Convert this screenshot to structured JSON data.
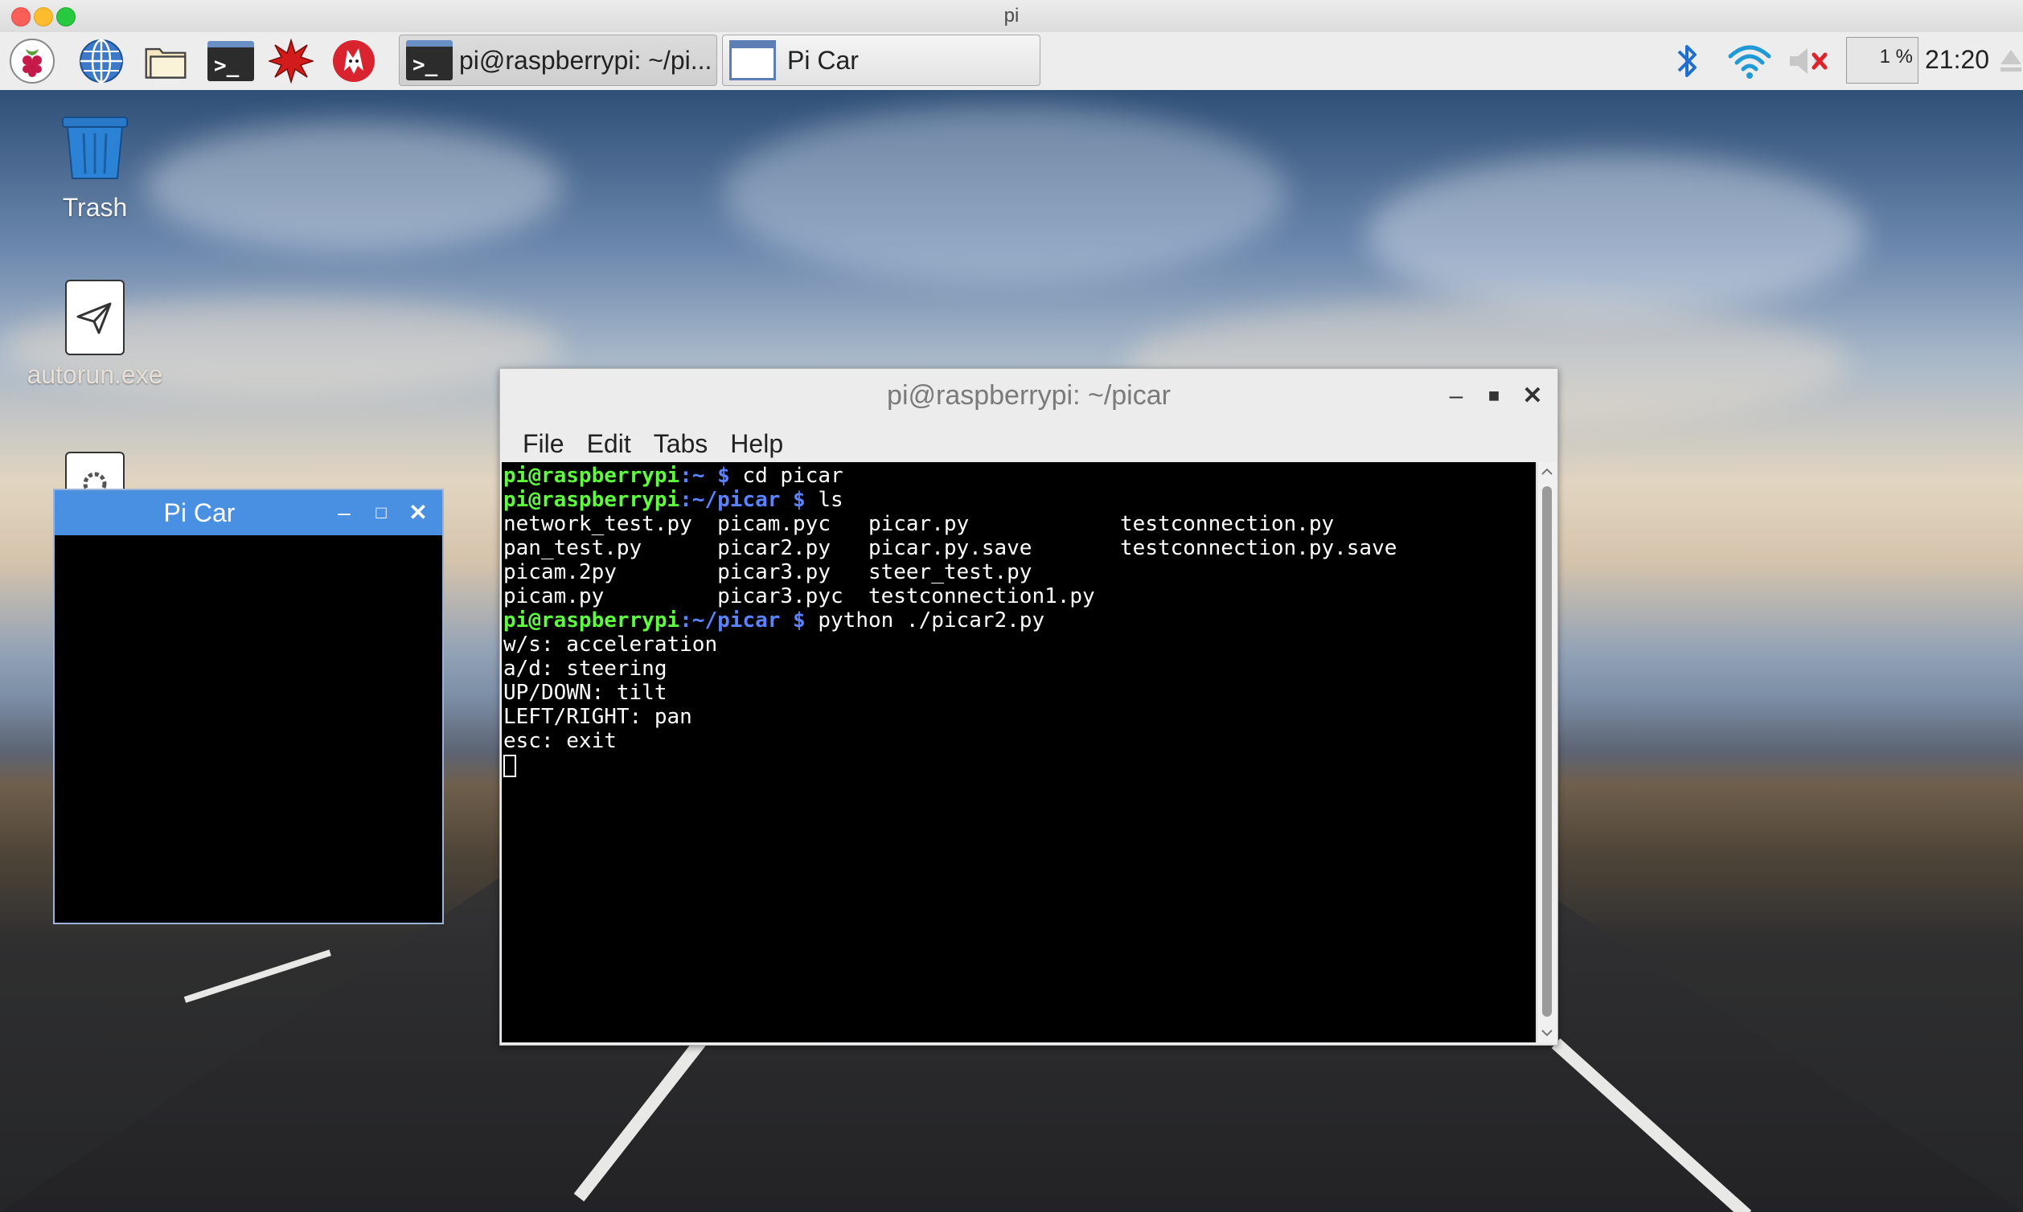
{
  "mac_window": {
    "title": "pi"
  },
  "taskbar": {
    "launchers": [
      "raspberry-menu-icon",
      "web-browser-icon",
      "file-manager-icon",
      "terminal-icon",
      "mathematica-icon",
      "wolfram-icon"
    ],
    "tasks": [
      {
        "label": "pi@raspberrypi: ~/pi...",
        "icon": "terminal-icon"
      },
      {
        "label": "Pi Car",
        "icon": "window-icon"
      }
    ],
    "cpu_label": "1 %",
    "clock": "21:20"
  },
  "desktop": {
    "icons": [
      {
        "label": "Trash",
        "icon": "trash-icon"
      },
      {
        "label": "autorun.exe",
        "icon": "paper-plane-file-icon"
      }
    ]
  },
  "picar_window": {
    "title": "Pi Car"
  },
  "terminal_window": {
    "title": "pi@raspberrypi: ~/picar",
    "menu": [
      "File",
      "Edit",
      "Tabs",
      "Help"
    ],
    "prompt_user": "pi@raspberrypi",
    "lines": [
      {
        "path": ":~ $",
        "cmd": " cd picar"
      },
      {
        "path": ":~/picar $",
        "cmd": " ls"
      },
      {
        "text": "network_test.py  picam.pyc   picar.py            testconnection.py"
      },
      {
        "text": "pan_test.py      picar2.py   picar.py.save       testconnection.py.save"
      },
      {
        "text": "picam.2py        picar3.py   steer_test.py"
      },
      {
        "text": "picam.py         picar3.pyc  testconnection1.py"
      },
      {
        "path": ":~/picar $",
        "cmd": " python ./picar2.py"
      },
      {
        "text": "w/s: acceleration"
      },
      {
        "text": "a/d: steering"
      },
      {
        "text": "UP/DOWN: tilt"
      },
      {
        "text": "LEFT/RIGHT: pan"
      },
      {
        "text": "esc: exit"
      }
    ]
  },
  "colors": {
    "prompt_green": "#5dfc3c",
    "prompt_blue": "#5b82ff",
    "picar_titlebar": "#4a90e2"
  }
}
